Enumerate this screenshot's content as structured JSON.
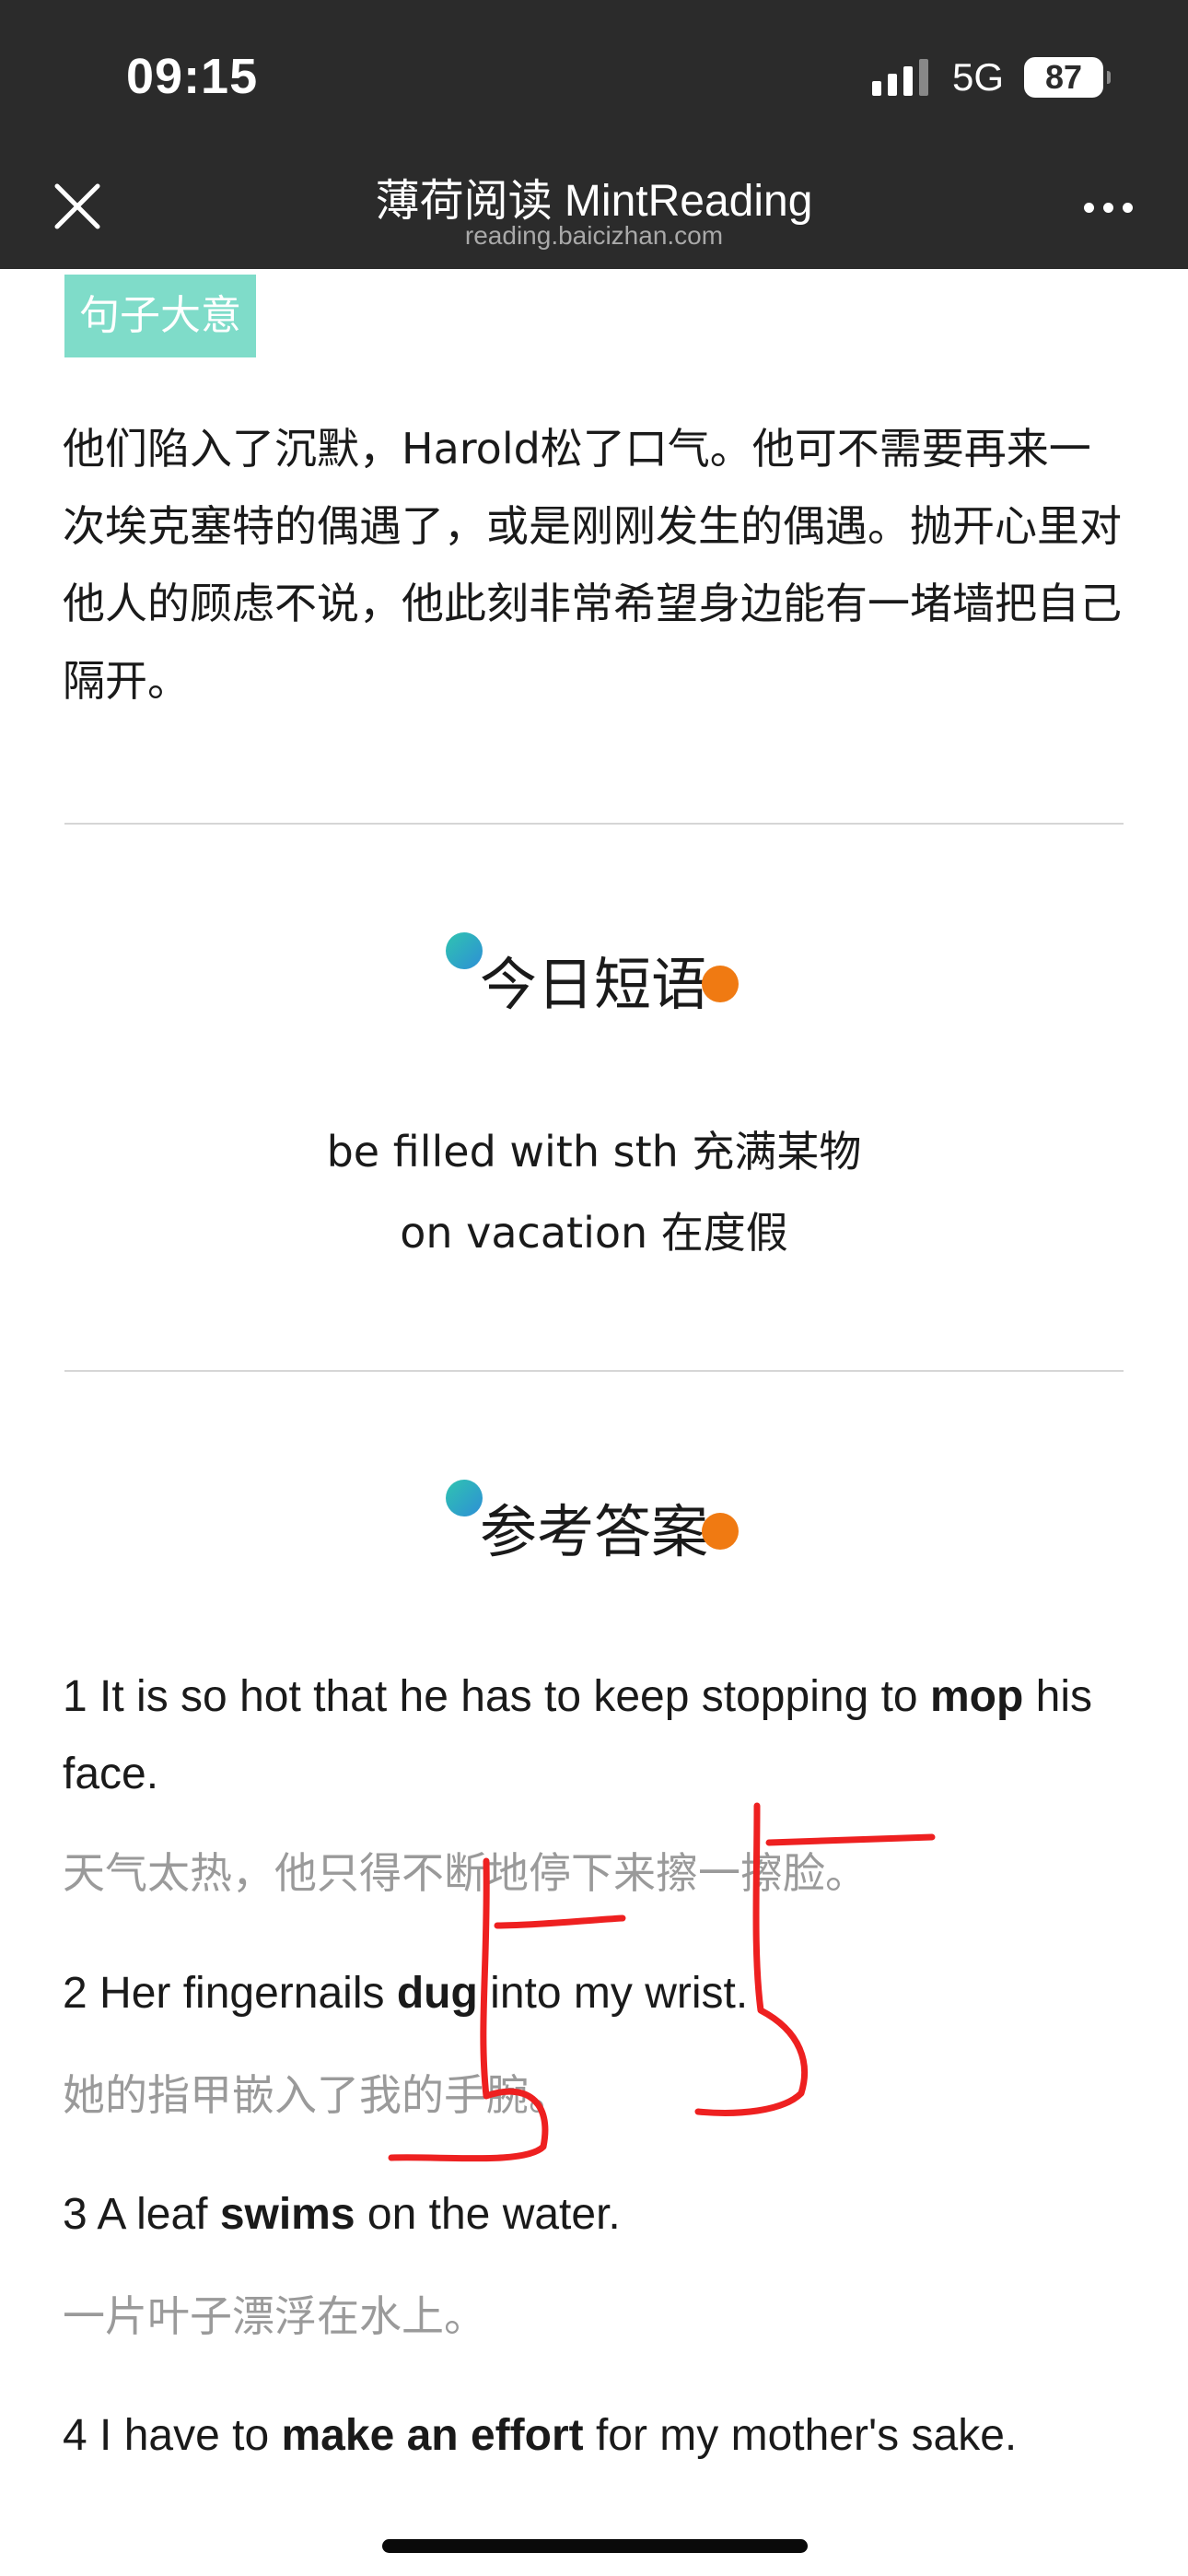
{
  "status_bar": {
    "time": "09:15",
    "network": "5G",
    "battery": "87"
  },
  "nav": {
    "title": "薄荷阅读 MintReading",
    "subtitle": "reading.baicizhan.com"
  },
  "tag_label": "句子大意",
  "paragraph": "他们陷入了沉默，Harold松了口气。他可不需要再来一次埃克塞特的偶遇了，或是刚刚发生的偶遇。抛开心里对他人的顾虑不说，他此刻非常希望身边能有一堵墙把自己隔开。",
  "phrases_section": {
    "heading": "今日短语",
    "items": [
      "be filled with sth 充满某物",
      "on vacation 在度假"
    ]
  },
  "answers_section": {
    "heading": "参考答案",
    "items": [
      {
        "pre": "1 It is so hot that he has to keep stopping to ",
        "word": "mop",
        "post": " his face.",
        "translation": "天气太热，他只得不断地停下来擦一擦脸。"
      },
      {
        "pre": "2 Her fingernails ",
        "word": "dug",
        "post": " into my wrist.",
        "translation": "她的指甲嵌入了我的手腕。"
      },
      {
        "pre": "3 A leaf ",
        "word": "swims",
        "post": " on the water.",
        "translation": "一片叶子漂浮在水上。"
      },
      {
        "pre": "4 I have to ",
        "word": "make an effort",
        "post": " for my mother's sake.",
        "translation": ""
      }
    ]
  },
  "colors": {
    "header_bg": "#2b2b2b",
    "tag_bg": "#7fdcc9",
    "highlight": "#ffe200",
    "dot_orange": "#f07a12",
    "annotation_red": "#ee2020"
  }
}
